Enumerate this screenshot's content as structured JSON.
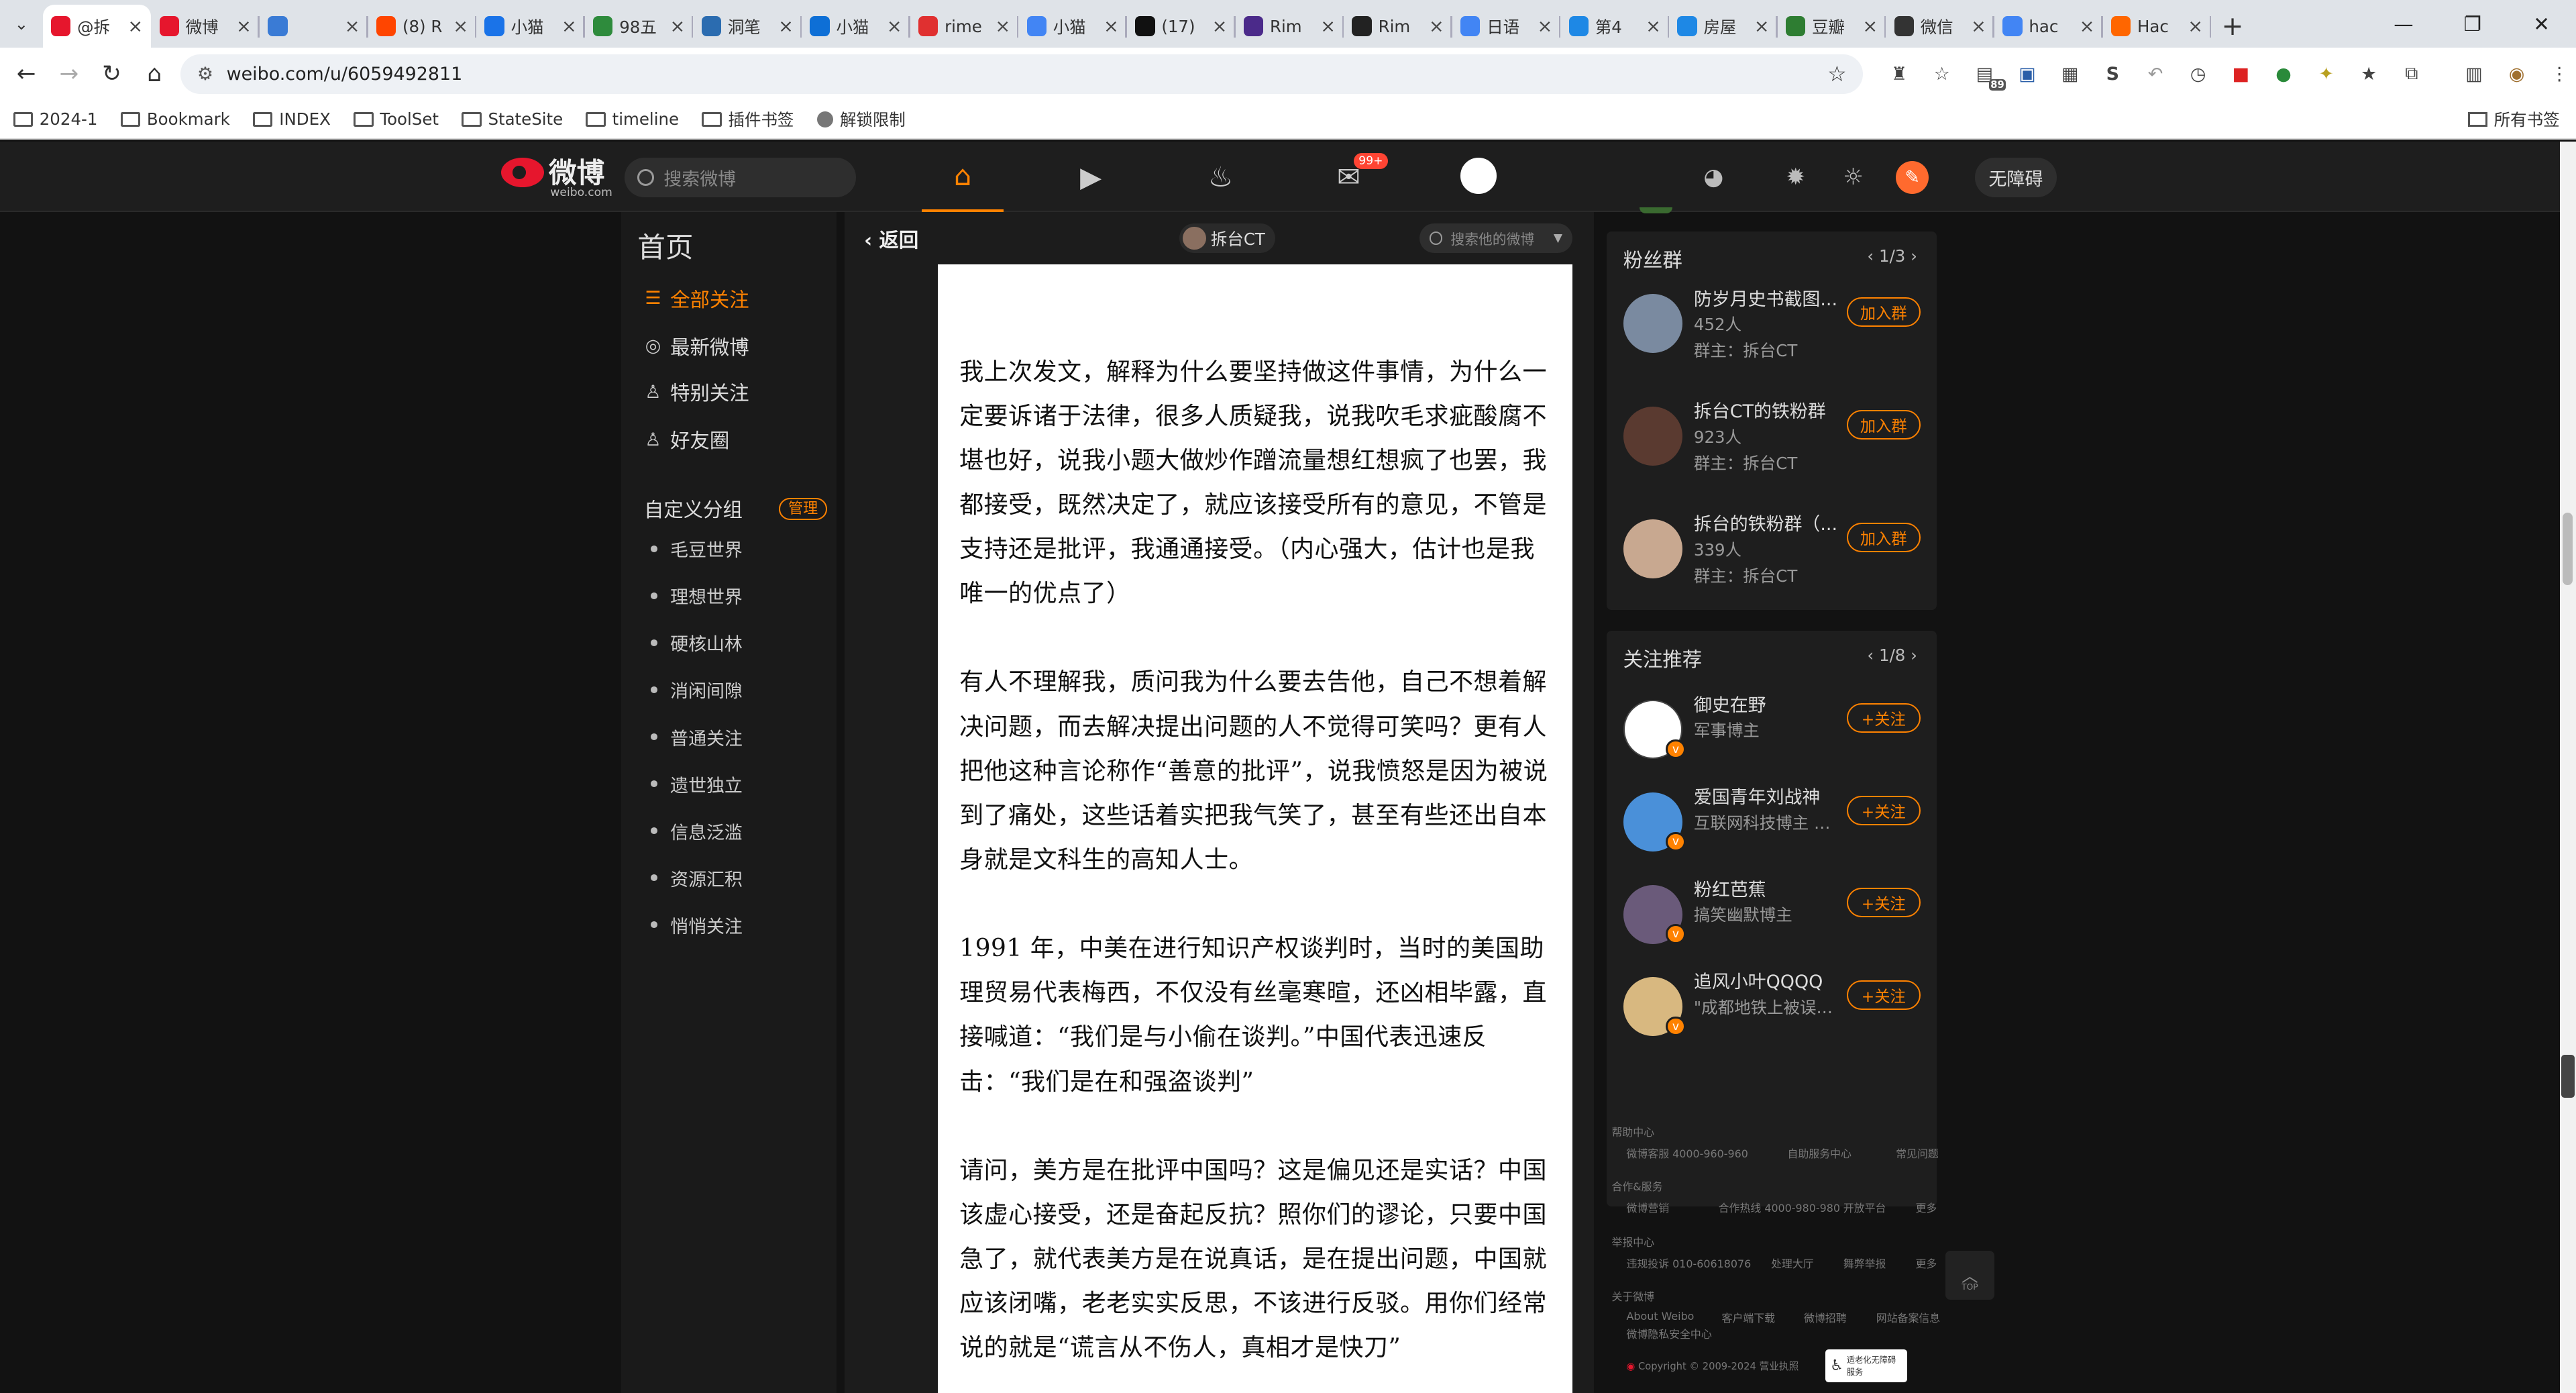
{
  "browser": {
    "tabs": [
      {
        "label": "@拆",
        "color": "#e6162d",
        "active": true
      },
      {
        "label": "微博",
        "color": "#e6162d"
      },
      {
        "label": "  ",
        "color": "#3a7bd5"
      },
      {
        "label": "(8) R",
        "color": "#ff4500"
      },
      {
        "label": "小猫",
        "color": "#1a73e8"
      },
      {
        "label": "98五",
        "color": "#2e8b3c"
      },
      {
        "label": "洞笔",
        "color": "#2b6cb0"
      },
      {
        "label": "小猫",
        "color": "#0e6fd6"
      },
      {
        "label": "rime",
        "color": "#e03030"
      },
      {
        "label": "小猫",
        "color": "#4285f4"
      },
      {
        "label": "(17)",
        "color": "#111111"
      },
      {
        "label": "Rim",
        "color": "#4b2a8a"
      },
      {
        "label": "Rim",
        "color": "#222222"
      },
      {
        "label": "日语",
        "color": "#4285f4"
      },
      {
        "label": "第4",
        "color": "#1e88e5"
      },
      {
        "label": "房屋",
        "color": "#1e88e5"
      },
      {
        "label": "豆瓣",
        "color": "#2e7d32"
      },
      {
        "label": "微信",
        "color": "#333333"
      },
      {
        "label": "hac",
        "color": "#4285f4"
      },
      {
        "label": "Hac",
        "color": "#ff6600"
      }
    ],
    "url": "weibo.com/u/6059492811",
    "ext_badge": "89",
    "bookmarks": [
      "2024-1",
      "Bookmark",
      "INDEX",
      "ToolSet",
      "StateSite",
      "timeline",
      "插件书签",
      "解锁限制"
    ],
    "bookmarks_right": "所有书签"
  },
  "weibo": {
    "logo": "微博",
    "logo_sub": "weibo.com",
    "search_placeholder": "搜索微博",
    "mail_badge": "99+",
    "a11y": "无障碍",
    "left": {
      "home": "首页",
      "items": [
        "全部关注",
        "最新微博",
        "特别关注",
        "好友圈"
      ],
      "group_title": "自定义分组",
      "manage": "管理",
      "groups": [
        "毛豆世界",
        "理想世界",
        "硬核山林",
        "消闲间隙",
        "普通关注",
        "遗世独立",
        "信息泛滥",
        "资源汇积",
        "悄悄关注"
      ]
    },
    "center": {
      "back": "返回",
      "author": "拆台CT",
      "search_placeholder": "搜索他的微博",
      "paragraphs": [
        "我上次发文，解释为什么要坚持做这件事情，为什么一定要诉诸于法律，很多人质疑我，说我吹毛求疵酸腐不堪也好，说我小题大做炒作蹭流量想红想疯了也罢，我都接受，既然决定了，就应该接受所有的意见，不管是支持还是批评，我通通接受。（内心强大，估计也是我唯一的优点了）",
        "有人不理解我，质问我为什么要去告他，自己不想着解决问题，而去解决提出问题的人不觉得可笑吗？更有人把他这种言论称作“善意的批评”，说我愤怒是因为被说到了痛处，这些话着实把我气笑了，甚至有些还出自本身就是文科生的高知人士。",
        "1991 年，中美在进行知识产权谈判时，当时的美国助理贸易代表梅西，不仅没有丝毫寒暄，还凶相毕露，直接喊道：“我们是与小偷在谈判。”中国代表迅速反击：“我们是在和强盗谈判”",
        "请问，美方是在批评中国吗？这是偏见还是实话？中国该虚心接受，还是奋起反抗？照你们的谬论，只要中国急了，就代表美方是在说真话，是在提出问题，中国就应该闭嘴，老老实实反思，不该进行反驳。用你们经常说的就是“谎言从不伤人，真相才是快刀”"
      ]
    },
    "fan_groups": {
      "title": "粉丝群",
      "pager": "1/3",
      "items": [
        {
          "name": "防岁月史书截图...",
          "count": "452人",
          "owner": "群主：拆台CT",
          "button": "加入群",
          "color": "#7a8aa0"
        },
        {
          "name": "拆台CT的铁粉群",
          "count": "923人",
          "owner": "群主：拆台CT",
          "button": "加入群",
          "color": "#5a3a30"
        },
        {
          "name": "拆台的铁粉群（...",
          "count": "339人",
          "owner": "群主：拆台CT",
          "button": "加入群",
          "color": "#c8a890"
        }
      ]
    },
    "recommend": {
      "title": "关注推荐",
      "pager": "1/8",
      "items": [
        {
          "name": "御史在野",
          "desc": "军事博主",
          "button": "+关注",
          "color": "#ffffff"
        },
        {
          "name": "爱国青年刘战神",
          "desc": "互联网科技博主 微...",
          "button": "+关注",
          "color": "#4a90d9"
        },
        {
          "name": "粉红芭蕉",
          "desc": "搞笑幽默博主",
          "button": "+关注",
          "color": "#6a5a7a"
        },
        {
          "name": "追风小叶QQQQ",
          "desc": "\"成都地铁上被误认...",
          "button": "+关注",
          "color": "#d8b880"
        }
      ]
    },
    "footer": {
      "help": "帮助中心",
      "help_links": [
        "微博客服 4000-960-960",
        "自助服务中心",
        "常见问题"
      ],
      "coop": "合作&服务",
      "coop_links": [
        "微博营销",
        "合作热线 4000-980-980",
        "开放平台",
        "更多"
      ],
      "report": "举报中心",
      "report_links": [
        "违规投诉 010-60618076",
        "处理大厅",
        "舞弊举报",
        "更多"
      ],
      "about": "关于微博",
      "about_links": [
        "About Weibo",
        "客户端下载",
        "微博招聘",
        "网站备案信息"
      ],
      "privacy": "微博隐私安全中心",
      "copyright": "Copyright © 2009-2024 营业执照",
      "badge": "适老化无障碍服务",
      "top": "TOP"
    }
  }
}
